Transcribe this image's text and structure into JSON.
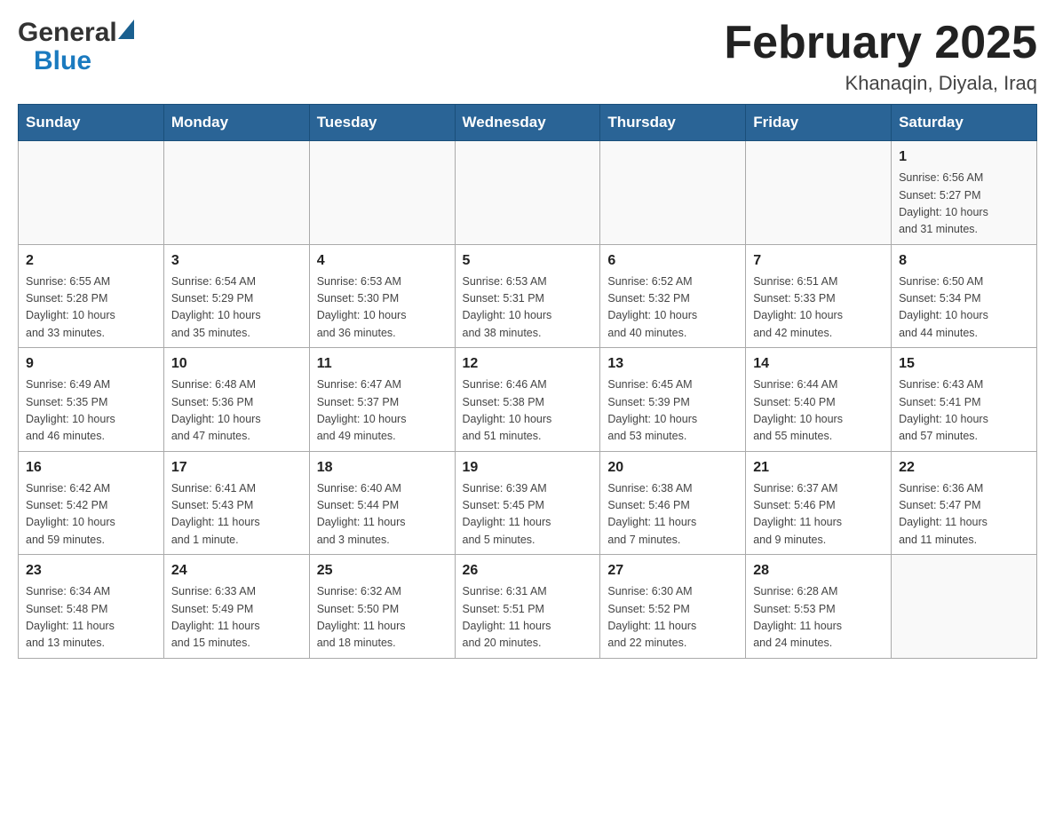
{
  "header": {
    "logo": {
      "general": "General",
      "blue": "Blue"
    },
    "title": "February 2025",
    "location": "Khanaqin, Diyala, Iraq"
  },
  "days_of_week": [
    "Sunday",
    "Monday",
    "Tuesday",
    "Wednesday",
    "Thursday",
    "Friday",
    "Saturday"
  ],
  "weeks": [
    {
      "days": [
        {
          "number": "",
          "info": ""
        },
        {
          "number": "",
          "info": ""
        },
        {
          "number": "",
          "info": ""
        },
        {
          "number": "",
          "info": ""
        },
        {
          "number": "",
          "info": ""
        },
        {
          "number": "",
          "info": ""
        },
        {
          "number": "1",
          "info": "Sunrise: 6:56 AM\nSunset: 5:27 PM\nDaylight: 10 hours\nand 31 minutes."
        }
      ]
    },
    {
      "days": [
        {
          "number": "2",
          "info": "Sunrise: 6:55 AM\nSunset: 5:28 PM\nDaylight: 10 hours\nand 33 minutes."
        },
        {
          "number": "3",
          "info": "Sunrise: 6:54 AM\nSunset: 5:29 PM\nDaylight: 10 hours\nand 35 minutes."
        },
        {
          "number": "4",
          "info": "Sunrise: 6:53 AM\nSunset: 5:30 PM\nDaylight: 10 hours\nand 36 minutes."
        },
        {
          "number": "5",
          "info": "Sunrise: 6:53 AM\nSunset: 5:31 PM\nDaylight: 10 hours\nand 38 minutes."
        },
        {
          "number": "6",
          "info": "Sunrise: 6:52 AM\nSunset: 5:32 PM\nDaylight: 10 hours\nand 40 minutes."
        },
        {
          "number": "7",
          "info": "Sunrise: 6:51 AM\nSunset: 5:33 PM\nDaylight: 10 hours\nand 42 minutes."
        },
        {
          "number": "8",
          "info": "Sunrise: 6:50 AM\nSunset: 5:34 PM\nDaylight: 10 hours\nand 44 minutes."
        }
      ]
    },
    {
      "days": [
        {
          "number": "9",
          "info": "Sunrise: 6:49 AM\nSunset: 5:35 PM\nDaylight: 10 hours\nand 46 minutes."
        },
        {
          "number": "10",
          "info": "Sunrise: 6:48 AM\nSunset: 5:36 PM\nDaylight: 10 hours\nand 47 minutes."
        },
        {
          "number": "11",
          "info": "Sunrise: 6:47 AM\nSunset: 5:37 PM\nDaylight: 10 hours\nand 49 minutes."
        },
        {
          "number": "12",
          "info": "Sunrise: 6:46 AM\nSunset: 5:38 PM\nDaylight: 10 hours\nand 51 minutes."
        },
        {
          "number": "13",
          "info": "Sunrise: 6:45 AM\nSunset: 5:39 PM\nDaylight: 10 hours\nand 53 minutes."
        },
        {
          "number": "14",
          "info": "Sunrise: 6:44 AM\nSunset: 5:40 PM\nDaylight: 10 hours\nand 55 minutes."
        },
        {
          "number": "15",
          "info": "Sunrise: 6:43 AM\nSunset: 5:41 PM\nDaylight: 10 hours\nand 57 minutes."
        }
      ]
    },
    {
      "days": [
        {
          "number": "16",
          "info": "Sunrise: 6:42 AM\nSunset: 5:42 PM\nDaylight: 10 hours\nand 59 minutes."
        },
        {
          "number": "17",
          "info": "Sunrise: 6:41 AM\nSunset: 5:43 PM\nDaylight: 11 hours\nand 1 minute."
        },
        {
          "number": "18",
          "info": "Sunrise: 6:40 AM\nSunset: 5:44 PM\nDaylight: 11 hours\nand 3 minutes."
        },
        {
          "number": "19",
          "info": "Sunrise: 6:39 AM\nSunset: 5:45 PM\nDaylight: 11 hours\nand 5 minutes."
        },
        {
          "number": "20",
          "info": "Sunrise: 6:38 AM\nSunset: 5:46 PM\nDaylight: 11 hours\nand 7 minutes."
        },
        {
          "number": "21",
          "info": "Sunrise: 6:37 AM\nSunset: 5:46 PM\nDaylight: 11 hours\nand 9 minutes."
        },
        {
          "number": "22",
          "info": "Sunrise: 6:36 AM\nSunset: 5:47 PM\nDaylight: 11 hours\nand 11 minutes."
        }
      ]
    },
    {
      "days": [
        {
          "number": "23",
          "info": "Sunrise: 6:34 AM\nSunset: 5:48 PM\nDaylight: 11 hours\nand 13 minutes."
        },
        {
          "number": "24",
          "info": "Sunrise: 6:33 AM\nSunset: 5:49 PM\nDaylight: 11 hours\nand 15 minutes."
        },
        {
          "number": "25",
          "info": "Sunrise: 6:32 AM\nSunset: 5:50 PM\nDaylight: 11 hours\nand 18 minutes."
        },
        {
          "number": "26",
          "info": "Sunrise: 6:31 AM\nSunset: 5:51 PM\nDaylight: 11 hours\nand 20 minutes."
        },
        {
          "number": "27",
          "info": "Sunrise: 6:30 AM\nSunset: 5:52 PM\nDaylight: 11 hours\nand 22 minutes."
        },
        {
          "number": "28",
          "info": "Sunrise: 6:28 AM\nSunset: 5:53 PM\nDaylight: 11 hours\nand 24 minutes."
        },
        {
          "number": "",
          "info": ""
        }
      ]
    }
  ]
}
